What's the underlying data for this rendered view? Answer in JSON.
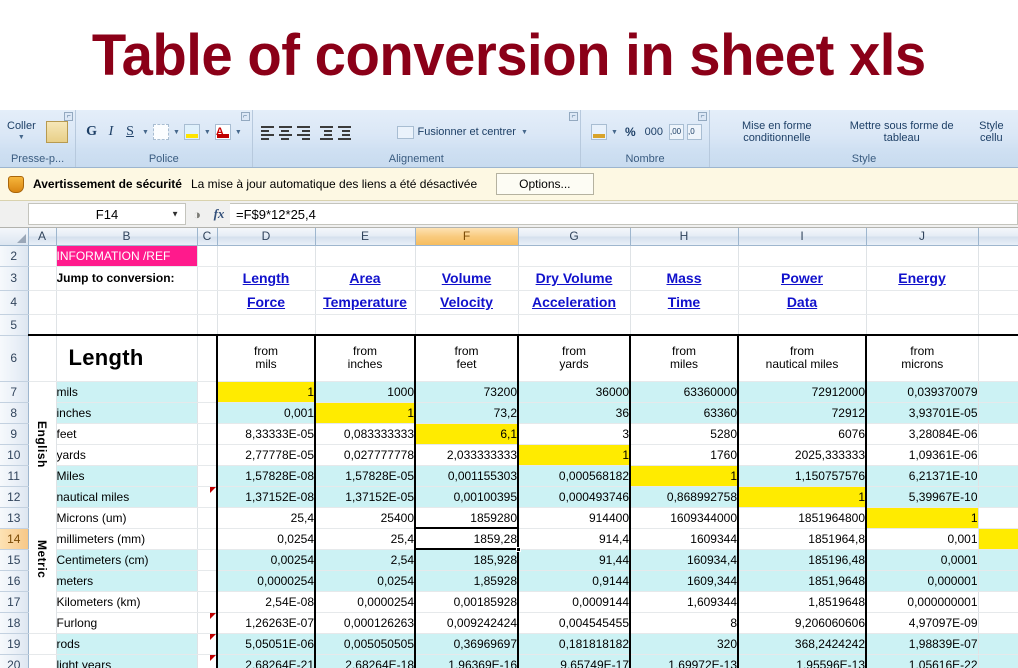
{
  "title": {
    "text": "Table of conversion in sheet xls",
    "color": "#8B0018"
  },
  "ribbon": {
    "groups": [
      {
        "name": "Presse-p...",
        "label": "Presse-p...",
        "paste_label": "Coller"
      },
      {
        "name": "Police",
        "label": "Police"
      },
      {
        "name": "Alignement",
        "label": "Alignement",
        "merge_label": "Fusionner et centrer"
      },
      {
        "name": "Nombre",
        "label": "Nombre",
        "percent": "%",
        "thousands": "000"
      },
      {
        "name": "Style",
        "label": "Style",
        "items": [
          "Mise en forme conditionnelle",
          "Mettre sous forme de tableau",
          "Style cellu"
        ]
      }
    ],
    "font_buttons": [
      "G",
      "I",
      "S"
    ]
  },
  "security": {
    "icon": "shield-icon",
    "title": "Avertissement de sécurité",
    "message": "La mise à jour automatique des liens a été désactivée",
    "options_label": "Options..."
  },
  "formula_bar": {
    "name_box": "F14",
    "fx_label": "fx",
    "formula": "=F$9*12*25,4"
  },
  "grid": {
    "columns": [
      "A",
      "B",
      "C",
      "D",
      "E",
      "F",
      "G",
      "H",
      "I",
      "J"
    ],
    "selected_column": "F",
    "selected_row": "14",
    "selected_cell": "F14",
    "row_numbers": [
      "2",
      "3",
      "4",
      "5",
      "6",
      "7",
      "8",
      "9",
      "10",
      "11",
      "12",
      "13",
      "14",
      "15",
      "16",
      "17",
      "18",
      "19",
      "20"
    ],
    "info_ref": "INFORMATION /REF",
    "jump_label": "Jump to conversion:",
    "jump_links_row1": [
      "Length",
      "Area",
      "Volume",
      "Dry Volume",
      "Mass",
      "Power",
      "Energy"
    ],
    "jump_links_row2": [
      "Force",
      "Temperature",
      "Velocity",
      "Acceleration",
      "Time",
      "Data",
      ""
    ],
    "section_title": "Length",
    "from_word": "from",
    "from_units": [
      "mils",
      "inches",
      "feet",
      "yards",
      "miles",
      "nautical miles",
      "microns"
    ],
    "group_english": "English",
    "group_metric": "Metric",
    "rows": [
      {
        "n": "7",
        "unit": "mils",
        "band": "cyan",
        "diag": 0,
        "vals": [
          "1",
          "1000",
          "73200",
          "36000",
          "63360000",
          "72912000",
          "0,039370079"
        ]
      },
      {
        "n": "8",
        "unit": "inches",
        "band": "cyan",
        "diag": 1,
        "vals": [
          "0,001",
          "1",
          "73,2",
          "36",
          "63360",
          "72912",
          "3,93701E-05"
        ]
      },
      {
        "n": "9",
        "unit": "feet",
        "band": "white",
        "diag": 2,
        "vals": [
          "8,33333E-05",
          "0,083333333",
          "6,1",
          "3",
          "5280",
          "6076",
          "3,28084E-06"
        ]
      },
      {
        "n": "10",
        "unit": "yards",
        "band": "white",
        "diag": 3,
        "vals": [
          "2,77778E-05",
          "0,027777778",
          "2,033333333",
          "1",
          "1760",
          "2025,333333",
          "1,09361E-06"
        ]
      },
      {
        "n": "11",
        "unit": "Miles",
        "band": "cyan",
        "diag": 4,
        "vals": [
          "1,57828E-08",
          "1,57828E-05",
          "0,001155303",
          "0,000568182",
          "1",
          "1,150757576",
          "6,21371E-10"
        ]
      },
      {
        "n": "12",
        "unit": "nautical miles",
        "band": "cyan",
        "diag": 5,
        "vals": [
          "1,37152E-08",
          "1,37152E-05",
          "0,00100395",
          "0,000493746",
          "0,868992758",
          "1",
          "5,39967E-10"
        ],
        "comment": true
      },
      {
        "n": "13",
        "unit": "Microns (um)",
        "band": "white",
        "diag": 6,
        "vals": [
          "25,4",
          "25400",
          "1859280",
          "914400",
          "1609344000",
          "1851964800",
          "1"
        ]
      },
      {
        "n": "14",
        "unit": "millimeters (mm)",
        "band": "white",
        "diag": -1,
        "vals": [
          "0,0254",
          "25,4",
          "1859,28",
          "914,4",
          "1609344",
          "1851964,8",
          "0,001"
        ]
      },
      {
        "n": "15",
        "unit": "Centimeters (cm)",
        "band": "cyan",
        "diag": -1,
        "vals": [
          "0,00254",
          "2,54",
          "185,928",
          "91,44",
          "160934,4",
          "185196,48",
          "0,0001"
        ]
      },
      {
        "n": "16",
        "unit": "meters",
        "band": "cyan",
        "diag": -1,
        "vals": [
          "0,0000254",
          "0,0254",
          "1,85928",
          "0,9144",
          "1609,344",
          "1851,9648",
          "0,000001"
        ]
      },
      {
        "n": "17",
        "unit": "Kilometers (km)",
        "band": "white",
        "diag": -1,
        "vals": [
          "2,54E-08",
          "0,0000254",
          "0,00185928",
          "0,0009144",
          "1,609344",
          "1,8519648",
          "0,000000001"
        ]
      },
      {
        "n": "18",
        "unit": "Furlong",
        "band": "white",
        "diag": -1,
        "vals": [
          "1,26263E-07",
          "0,000126263",
          "0,009242424",
          "0,004545455",
          "8",
          "9,206060606",
          "4,97097E-09"
        ],
        "comment": true
      },
      {
        "n": "19",
        "unit": "rods",
        "band": "cyan",
        "diag": -1,
        "vals": [
          "5,05051E-06",
          "0,005050505",
          "0,36969697",
          "0,181818182",
          "320",
          "368,2424242",
          "1,98839E-07"
        ],
        "comment": true
      },
      {
        "n": "20",
        "unit": "light years",
        "band": "cyan",
        "diag": -1,
        "vals": [
          "2,68264E-21",
          "2,68264E-18",
          "1,96369E-16",
          "9,65749E-17",
          "1,69972E-13",
          "1,95596E-13",
          "1,05616E-22"
        ],
        "comment": true
      }
    ]
  }
}
